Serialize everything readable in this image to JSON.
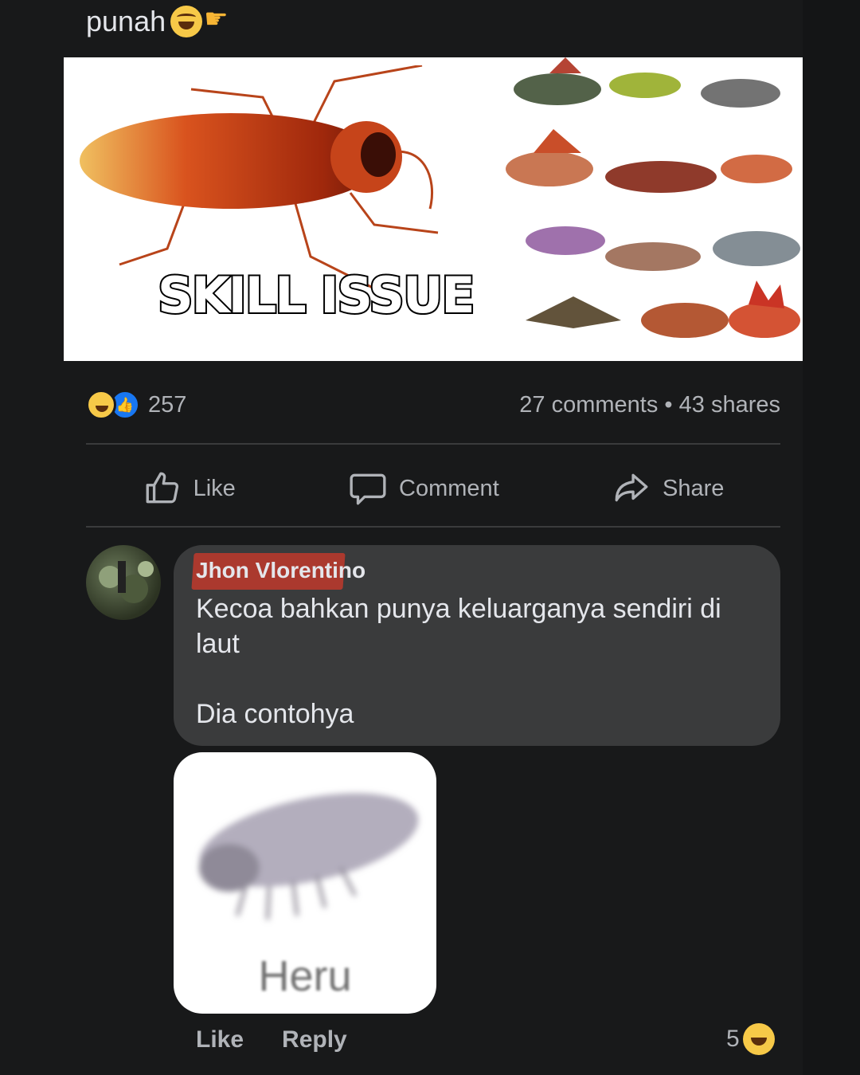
{
  "post": {
    "text": "punah",
    "emoji_icons": [
      "rolling-laughing-icon",
      "pointing-right-icon"
    ],
    "image": {
      "caption": "SKILL ISSUE",
      "subjects": [
        "cockroach",
        "dinosaurs"
      ]
    }
  },
  "stats": {
    "reaction_icons": [
      "haha-icon",
      "like-icon"
    ],
    "reaction_count": "257",
    "comments": "27 comments",
    "separator": "•",
    "shares": "43 shares"
  },
  "actions": {
    "like": "Like",
    "comment": "Comment",
    "share": "Share"
  },
  "comment": {
    "author": "Jhon Vlorentino",
    "line1": "Kecoa bahkan punya keluarganya sendiri di laut",
    "line2": "Dia contohya",
    "attachment_label": "Heru",
    "like": "Like",
    "reply": "Reply",
    "reaction_count": "5",
    "reaction_icon": "haha-icon"
  },
  "colors": {
    "background": "#18191a",
    "bubble": "#3a3b3c",
    "text_primary": "#e4e6eb",
    "text_secondary": "#b0b3b8",
    "like_blue": "#1877f2",
    "haha_yellow": "#f7c948"
  }
}
